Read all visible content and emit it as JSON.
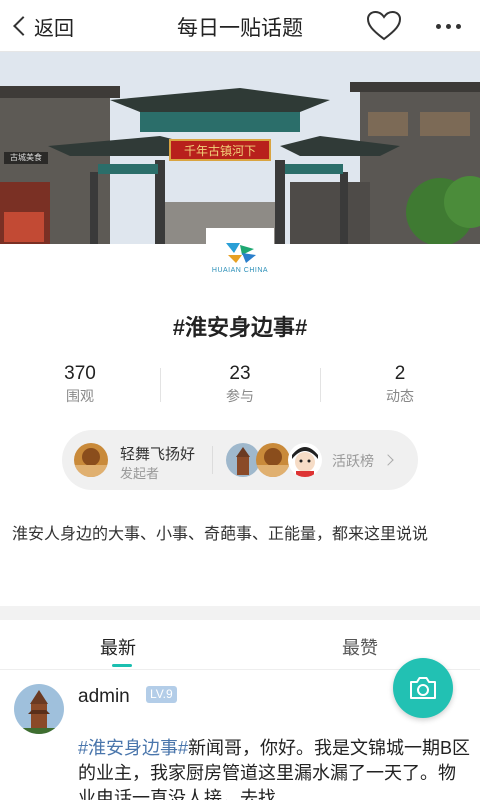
{
  "nav": {
    "back_label": "返回",
    "title": "每日一贴话题",
    "icons": [
      "back-chevron-icon",
      "heart-icon",
      "more-icon"
    ]
  },
  "banner": {
    "gate_sign": "千年古镇河下",
    "shop_sign": "古城美食",
    "logo_caption": "HUAIAN CHINA",
    "logo_text": "淮安"
  },
  "topic": {
    "title": "#淮安身边事#"
  },
  "stats": [
    {
      "value": "370",
      "label": "围观"
    },
    {
      "value": "23",
      "label": "参与"
    },
    {
      "value": "2",
      "label": "动态"
    }
  ],
  "initiator": {
    "name": "轻舞飞扬好",
    "role": "发起者",
    "rank_label": "活跃榜"
  },
  "description": "淮安人身边的大事、小事、奇葩事、正能量，都来这里说说",
  "tabs": [
    {
      "label": "最新",
      "active": true
    },
    {
      "label": "最赞",
      "active": false
    }
  ],
  "post": {
    "author": "admin",
    "level": "LV.9",
    "tag": "#淮安身边事#",
    "text": "新闻哥，你好。我是文锦城一期B区的业主，我家厨房管道这里漏水漏了一天了。物业电话一直没人接，去找"
  },
  "colors": {
    "accent": "#22c1b3",
    "tag_blue": "#4a76ac",
    "level_badge": "#b3cde8"
  }
}
